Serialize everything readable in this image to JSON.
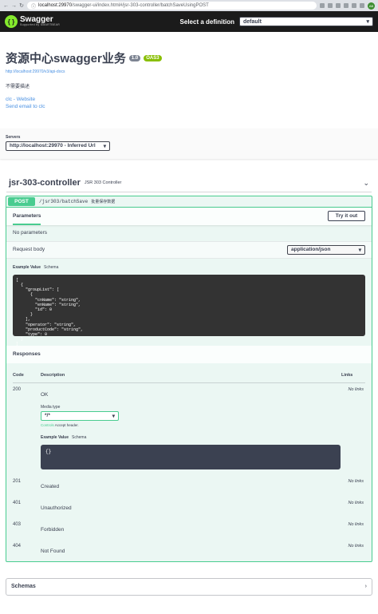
{
  "browser": {
    "url_host": "localhost:29970",
    "url_path": "/swagger-ui/index.html#/jsr-303-controller/batchSaveUsingPOST",
    "profile": "AB"
  },
  "topbar": {
    "logo_name": "Swagger",
    "logo_sub": "Supported by SMARTBEAR",
    "select_label": "Select a definition",
    "select_value": "default"
  },
  "info": {
    "title": "资源中心swagger业务",
    "version": "1.0",
    "oas": "OAS3",
    "doc_url": "http://localhost:29970/v3/api-docs",
    "description": "不需要描述",
    "contact_website": "clc - Website",
    "contact_email": "Send email to clc"
  },
  "servers": {
    "label": "Servers",
    "selected": "http://localhost:29970 - Inferred Url"
  },
  "tag": {
    "name": "jsr-303-controller",
    "description": "JSR 303 Controller"
  },
  "operation": {
    "method": "POST",
    "path": "/jsr303/batchSave",
    "summary": "批量保存数据",
    "parameters_title": "Parameters",
    "try_button": "Try it out",
    "no_params": "No parameters",
    "request_body_label": "Request body",
    "content_type": "application/json",
    "example_value_label": "Example Value",
    "schema_label": "Schema",
    "example_json": "[\n  {\n    \"groupList\": [\n      {\n        \"cnName\": \"string\",\n        \"enName\": \"string\",\n        \"id\": 0\n      }\n    ],\n    \"operator\": \"string\",\n    \"productCode\": \"string\",\n    \"type\": 0\n  }\n]"
  },
  "responses": {
    "title": "Responses",
    "col_code": "Code",
    "col_description": "Description",
    "col_links": "Links",
    "media_type_label": "Media type",
    "media_type_value": "*/*",
    "controls_text": "Controls",
    "controls_suffix": " Accept header.",
    "example_value_label": "Example Value",
    "schema_label": "Schema",
    "example_body": "{}",
    "rows": [
      {
        "code": "200",
        "description": "OK",
        "links": "No links"
      },
      {
        "code": "201",
        "description": "Created",
        "links": "No links"
      },
      {
        "code": "401",
        "description": "Unauthorized",
        "links": "No links"
      },
      {
        "code": "403",
        "description": "Forbidden",
        "links": "No links"
      },
      {
        "code": "404",
        "description": "Not Found",
        "links": "No links"
      }
    ]
  },
  "schemas": {
    "title": "Schemas"
  }
}
